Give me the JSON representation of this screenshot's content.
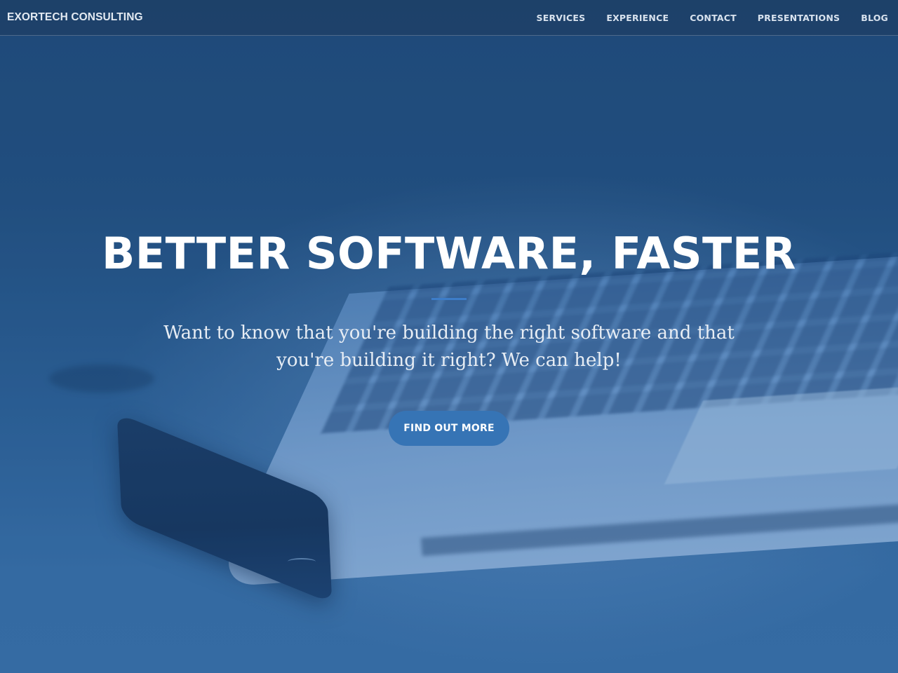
{
  "navbar": {
    "brand": "EXORTECH CONSULTING",
    "links": [
      {
        "label": "SERVICES"
      },
      {
        "label": "EXPERIENCE"
      },
      {
        "label": "CONTACT"
      },
      {
        "label": "PRESENTATIONS"
      },
      {
        "label": "BLOG"
      }
    ]
  },
  "hero": {
    "title": "BETTER SOFTWARE, FASTER",
    "subtitle": "Want to know that you're building the right software and that you're building it right? We can help!",
    "cta_label": "FIND OUT MORE"
  },
  "colors": {
    "accent": "#3674b5",
    "divider": "#3d7dc9",
    "hero_tint": "#23507f"
  }
}
